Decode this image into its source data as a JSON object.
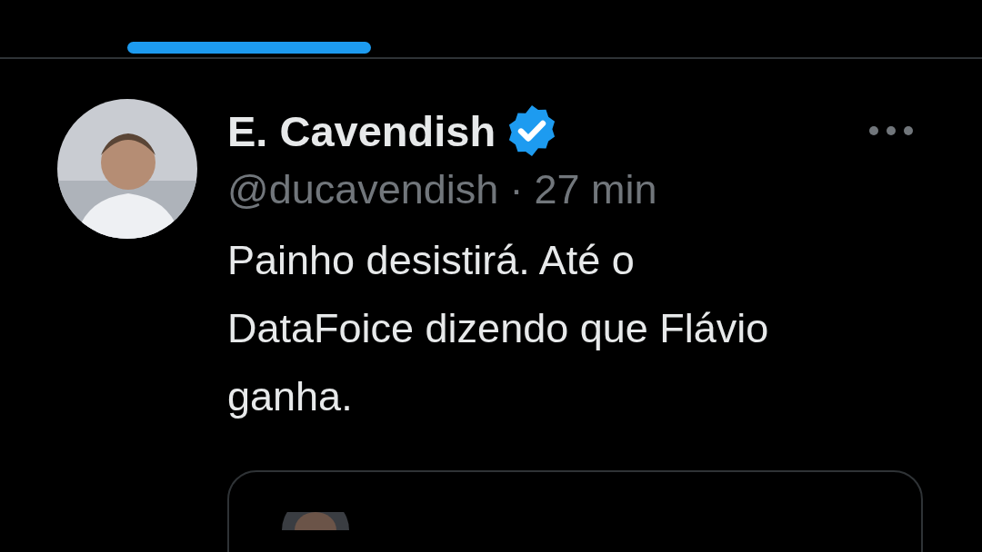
{
  "tabs": [
    {
      "selected": true
    }
  ],
  "tweet": {
    "author": "E. Cavendish",
    "verified": true,
    "handle": "@ducavendish",
    "separator": "·",
    "time": "27 min",
    "text_lines": [
      "Painho desistirá. Até o",
      "DataFoice dizendo que Flávio",
      "ganha."
    ]
  }
}
